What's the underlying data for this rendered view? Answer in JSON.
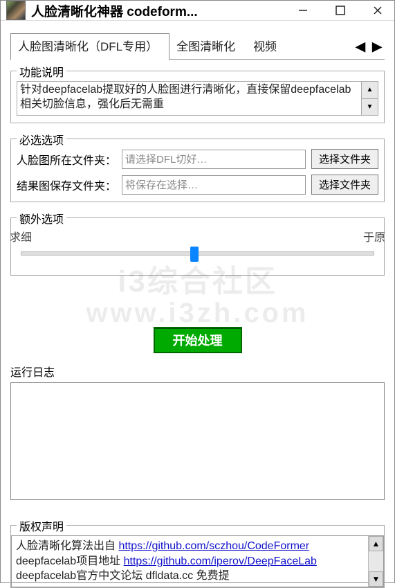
{
  "window": {
    "title": "人脸清晰化神器 codeform..."
  },
  "tabs": {
    "items": [
      {
        "label": "人脸图清晰化（DFL专用）"
      },
      {
        "label": "全图清晰化"
      },
      {
        "label": "视频"
      }
    ]
  },
  "group_desc": {
    "title": "功能说明",
    "text": "针对deepfacelab提取好的人脸图进行清晰化，直接保留deepfacelab相关切脸信息，强化后无需重"
  },
  "group_required": {
    "title": "必选选项",
    "rows": {
      "input_folder_label": "人脸图所在文件夹：",
      "input_folder_placeholder": "请选择DFL切好…",
      "output_folder_label": "结果图保存文件夹：",
      "output_folder_placeholder": "将保存在选择…",
      "choose_btn": "选择文件夹"
    }
  },
  "group_extra": {
    "title": "额外选项",
    "slider_left": "求细",
    "slider_right": "于原"
  },
  "start_button": "开始处理",
  "log": {
    "title": "运行日志"
  },
  "copyright": {
    "title": "版权声明",
    "line1_text": "人脸清晰化算法出自 ",
    "line1_link": "https://github.com/sczhou/CodeFormer",
    "line2_text": "deepfacelab项目地址 ",
    "line2_link": "https://github.com/iperov/DeepFaceLab",
    "line3_text": "deepfacelab官方中文论坛 dfldata.cc 免费提"
  },
  "watermark": {
    "line1": "i3综合社区",
    "line2": "www.i3zh.com"
  }
}
